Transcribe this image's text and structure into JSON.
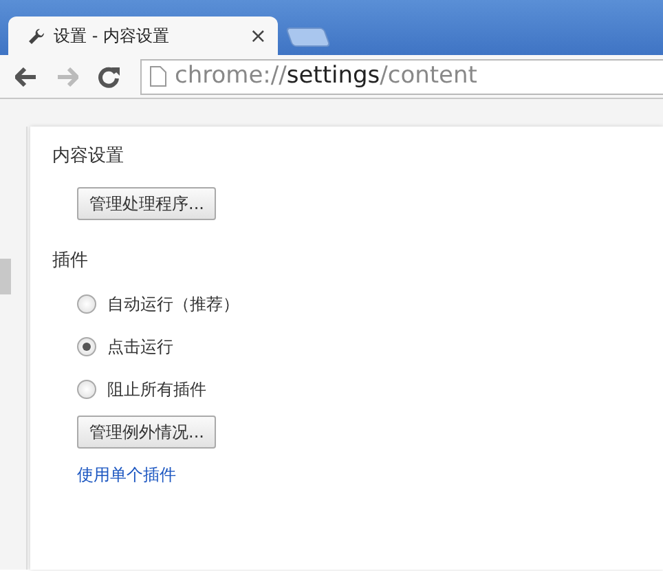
{
  "tab": {
    "title": "设置 - 内容设置",
    "close": "×"
  },
  "address": {
    "scheme": "chrome://",
    "host": "settings",
    "path": "/content"
  },
  "heading": "内容设置",
  "handlers_button": "管理处理程序...",
  "plugins": {
    "title": "插件",
    "options": [
      {
        "label": "自动运行（推荐）",
        "selected": false
      },
      {
        "label": "点击运行",
        "selected": true
      },
      {
        "label": "阻止所有插件",
        "selected": false
      }
    ],
    "exceptions_button": "管理例外情况...",
    "link": "使用单个插件"
  }
}
